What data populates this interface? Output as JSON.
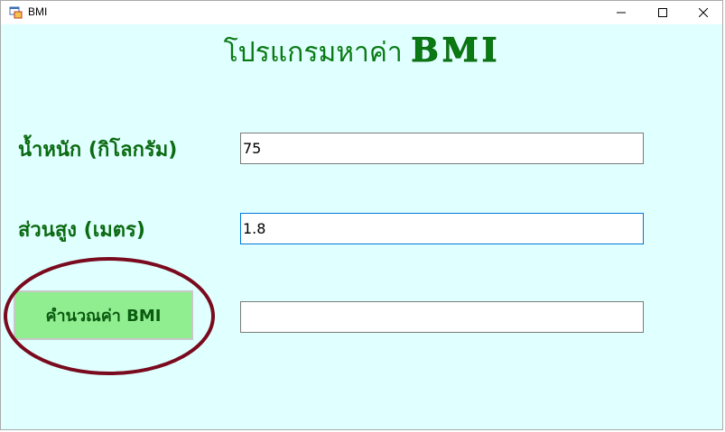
{
  "window": {
    "title": "BMI",
    "controls": {
      "minimize": "minimize-icon",
      "maximize": "maximize-icon",
      "close": "close-icon"
    }
  },
  "header": {
    "title_thai": "โปรแกรมหาค่า",
    "title_brand": "BMI"
  },
  "form": {
    "weight_label": "น้ำหนัก (กิโลกรัม)",
    "weight_value": "75",
    "height_label": "ส่วนสูง (เมตร)",
    "height_value": "1.8",
    "calc_button_label": "คำนวณค่า BMI",
    "result_value": ""
  },
  "colors": {
    "background": "#e0ffff",
    "title_green": "#0a7a13",
    "button_green": "#90ee90",
    "highlight_circle": "#7a0a1e"
  }
}
